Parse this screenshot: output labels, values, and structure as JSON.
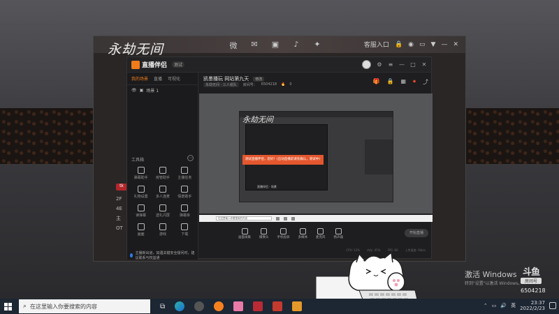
{
  "launcher": {
    "logo": "永劫无间",
    "social": [
      "微",
      "✉",
      "▣",
      "♪",
      "✦"
    ],
    "account": "客服入口",
    "left_chip": "tk",
    "bullets": [
      "2F",
      "4E",
      "主",
      "OT"
    ]
  },
  "app": {
    "name": "直播伴侣",
    "version": "测试",
    "tabs": [
      "我的场景",
      "直播",
      "可视化"
    ],
    "scene_label": "场景 1",
    "tools_label": "工具箱",
    "tools": [
      {
        "label": "弹幕助手"
      },
      {
        "label": "房管助手"
      },
      {
        "label": "主播任务"
      },
      {
        "label": "礼物设置"
      },
      {
        "label": "多人连麦"
      },
      {
        "label": "情景助手"
      },
      {
        "label": "读弹幕"
      },
      {
        "label": "送礼闪屏"
      },
      {
        "label": "弹幕库"
      },
      {
        "label": "画面"
      },
      {
        "label": "游戏"
      },
      {
        "label": "下载"
      }
    ],
    "notice": "主播新出道，如遇关键安全疑问时，建议联系与权益通",
    "room_title": "凯墨播玩 网站第九天",
    "room_title_edit": "修改",
    "room_category": "永劫无间 · 三人组队",
    "room_id_label": "房间号：",
    "room_id": "6504218",
    "room_hot": "0",
    "preview_banner": "测试直播伴侣，您好！(启动直播前请先确认，测试中)",
    "preview_logo": "永劫无间",
    "preview_chip": "直播伴侣 · 场景",
    "mini_search": "在这里输入你要搜索的内容",
    "controls": [
      "画面采集",
      "摄像头",
      "手机投屏",
      "多媒体",
      "麦克风",
      "扬声器"
    ],
    "start_button": "开始直播",
    "status": [
      "CPU: 12%",
      "内存: 45%",
      "FPS: 60",
      "上传速度: 0kb/s"
    ]
  },
  "watermark": {
    "activate_title": "激活 Windows",
    "activate_sub": "转到\"设置\"以激活 Windows。",
    "douyu_logo": "斗鱼",
    "douyu_sub": "房间号",
    "room_id": "6504218"
  },
  "taskbar": {
    "search_placeholder": "在这里输入你要搜索的内容",
    "clock_time": "23:37",
    "clock_date": "2022/2/23",
    "lang": "英"
  }
}
